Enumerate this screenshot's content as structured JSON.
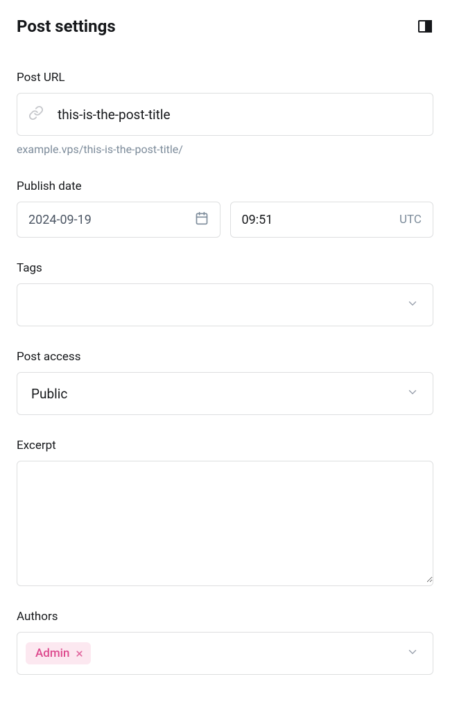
{
  "header": {
    "title": "Post settings"
  },
  "postUrl": {
    "label": "Post URL",
    "value": "this-is-the-post-title",
    "helper": "example.vps/this-is-the-post-title/"
  },
  "publishDate": {
    "label": "Publish date",
    "date": "2024-09-19",
    "time": "09:51",
    "timezone": "UTC"
  },
  "tags": {
    "label": "Tags",
    "value": ""
  },
  "postAccess": {
    "label": "Post access",
    "value": "Public"
  },
  "excerpt": {
    "label": "Excerpt",
    "value": ""
  },
  "authors": {
    "label": "Authors",
    "items": [
      {
        "name": "Admin"
      }
    ]
  }
}
